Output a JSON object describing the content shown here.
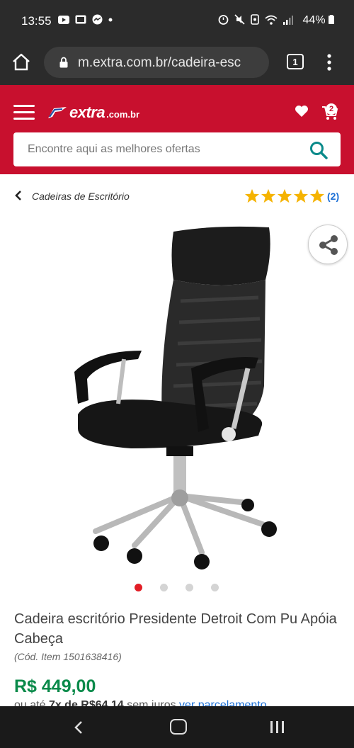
{
  "status_bar": {
    "time": "13:55",
    "battery": "44%"
  },
  "browser": {
    "url": "m.extra.com.br/cadeira-esc",
    "tab_count": "1"
  },
  "header": {
    "logo_text": "extra",
    "logo_domain": ".com.br",
    "cart_count": "2",
    "brand_color": "#c8102e",
    "search": {
      "placeholder": "Encontre aqui as melhores ofertas"
    }
  },
  "breadcrumb": {
    "category": "Cadeiras de Escritório"
  },
  "rating": {
    "stars": 5,
    "max_stars": 5,
    "count_label": "(2)"
  },
  "carousel": {
    "total": 4,
    "active_index": 0
  },
  "product": {
    "title": "Cadeira escritório Presidente Detroit Com Pu Apóia Cabeça",
    "code": "(Cód. Item 1501638416)",
    "price": "R$ 449,00",
    "installments_prefix": "ou até ",
    "installments_value": "7x de R$64,14",
    "installments_suffix": " sem juros ",
    "installments_link": "ver parcelamento",
    "price_color": "#0a8a4a"
  }
}
